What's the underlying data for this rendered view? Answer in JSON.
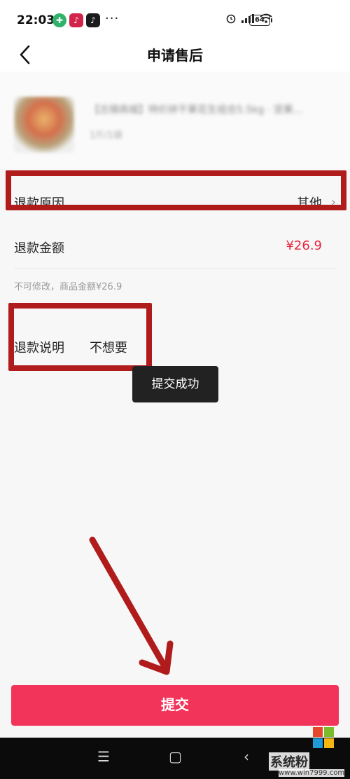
{
  "status_bar": {
    "time": "22:03",
    "app_badges": [
      "✚",
      "♪",
      "♪"
    ],
    "more": "···",
    "battery": "64"
  },
  "nav": {
    "title": "申请售后",
    "back_icon": "chevron-left-icon"
  },
  "product": {
    "name": "【古锦商城】特价拼干果花生组合5.5kg · 坚果…",
    "spec": "1斤/1袋"
  },
  "form": {
    "reason": {
      "label": "退款原因",
      "value": "其他"
    },
    "amount": {
      "label": "退款金额",
      "value": "¥26.9"
    },
    "hint": "不可修改，商品金额¥26.9",
    "explain": {
      "label": "退款说明",
      "value": "不想要"
    }
  },
  "toast": "提交成功",
  "submit_label": "提交",
  "watermark": {
    "title": "系统粉",
    "url": "www.win7999.com"
  },
  "colors": {
    "accent": "#f2345a",
    "price": "#e8263f",
    "annotation": "#b01c1c"
  }
}
